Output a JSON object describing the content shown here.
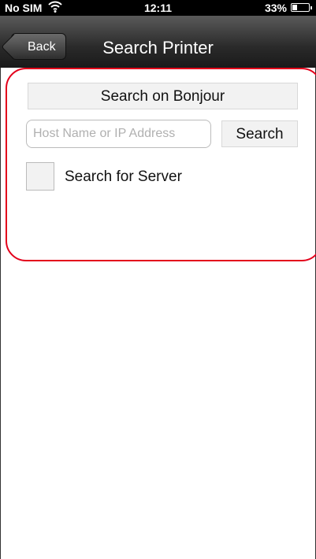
{
  "status_bar": {
    "carrier": "No SIM",
    "time": "12:11",
    "battery": "33%",
    "battery_level": 0.33
  },
  "nav": {
    "back_label": "Back",
    "title": "Search Printer"
  },
  "form": {
    "bonjour_label": "Search on Bonjour",
    "host_placeholder": "Host Name or IP Address",
    "host_value": "",
    "search_label": "Search",
    "server_checkbox_checked": false,
    "server_label": "Search for Server"
  },
  "colors": {
    "highlight": "#e3001b",
    "nav_bg": "#2a2a2a"
  }
}
